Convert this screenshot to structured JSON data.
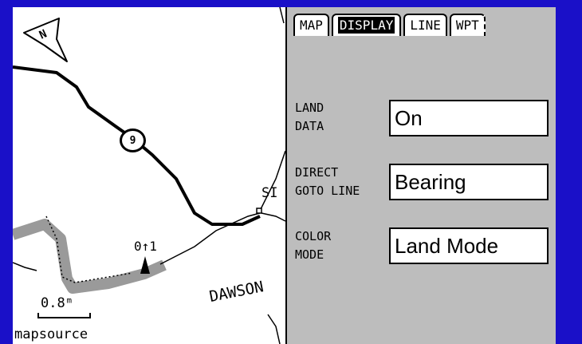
{
  "map": {
    "route_number": "9",
    "waypoint_label": "0↑1",
    "poi_label": "SI",
    "town_label": "DAWSON",
    "scale_label": "0.8ᵐ",
    "source_label": "mapsource",
    "north_arrow_letter": "N"
  },
  "tabs": [
    {
      "label": "MAP",
      "active": false
    },
    {
      "label": "DISPLAY",
      "active": true
    },
    {
      "label": "LINE",
      "active": false
    },
    {
      "label": "WPT",
      "active": false
    }
  ],
  "settings": [
    {
      "label": "LAND\nDATA",
      "value": "On"
    },
    {
      "label": "DIRECT\nGOTO LINE",
      "value": "Bearing"
    },
    {
      "label": "COLOR\nMODE",
      "value": "Land Mode"
    }
  ],
  "colors": {
    "frame": "#1a10c8",
    "panel": "#bdbdbd",
    "track": "#9a9a9a",
    "active_tab": "#000000"
  }
}
